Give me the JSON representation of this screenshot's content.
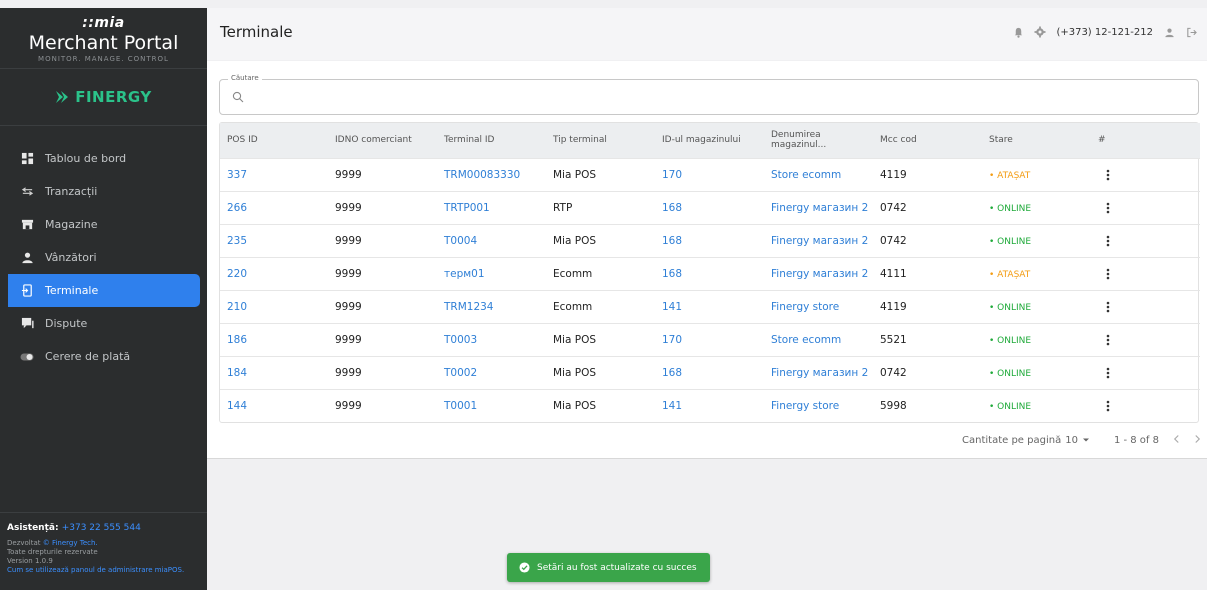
{
  "brand": {
    "logo_text": "mia",
    "title": "Merchant Portal",
    "tagline": "MONITOR. MANAGE. CONTROL",
    "merchant_logo": "FINERGY"
  },
  "nav": [
    {
      "label": "Tablou de bord",
      "icon": "dashboard-icon"
    },
    {
      "label": "Tranzacții",
      "icon": "arrows-icon"
    },
    {
      "label": "Magazine",
      "icon": "store-icon"
    },
    {
      "label": "Vânzători",
      "icon": "person-icon"
    },
    {
      "label": "Terminale",
      "icon": "terminal-icon",
      "active": true
    },
    {
      "label": "Dispute",
      "icon": "chat-icon"
    },
    {
      "label": "Cerere de plată",
      "icon": "toggle-icon"
    }
  ],
  "footer": {
    "assist_label": "Asistență:",
    "assist_phone": "+373 22 555 544",
    "dev_prefix": "Dezvoltat ",
    "dev_link": "© Finergy Tech.",
    "rights": "Toate drepturile rezervate",
    "version": "Version 1.0.9",
    "help_link": "Cum se utilizează panoul de administrare miaPOS."
  },
  "header": {
    "title": "Terminale",
    "phone": "(+373) 12-121-212"
  },
  "search": {
    "label": "Căutare",
    "value": "",
    "placeholder": ""
  },
  "table": {
    "columns": [
      "POS ID",
      "IDNO comerciant",
      "Terminal ID",
      "Tip terminal",
      "ID-ul magazinului",
      "Denumirea magazinul...",
      "Mcc cod",
      "Stare",
      "#"
    ],
    "rows": [
      {
        "pos_id": "337",
        "idno": "9999",
        "terminal_id": "TRM00083330",
        "type": "Mia POS",
        "store_id": "170",
        "store_name": "Store ecomm",
        "mcc": "4119",
        "status": "• ATAȘAT",
        "status_kind": "atasat"
      },
      {
        "pos_id": "266",
        "idno": "9999",
        "terminal_id": "TRTP001",
        "type": "RTP",
        "store_id": "168",
        "store_name": "Finergy магазин 2",
        "mcc": "0742",
        "status": "• ONLINE",
        "status_kind": "online"
      },
      {
        "pos_id": "235",
        "idno": "9999",
        "terminal_id": "T0004",
        "type": "Mia POS",
        "store_id": "168",
        "store_name": "Finergy магазин 2",
        "mcc": "0742",
        "status": "• ONLINE",
        "status_kind": "online"
      },
      {
        "pos_id": "220",
        "idno": "9999",
        "terminal_id": "терм01",
        "type": "Ecomm",
        "store_id": "168",
        "store_name": "Finergy магазин 2",
        "mcc": "4111",
        "status": "• ATAȘAT",
        "status_kind": "atasat"
      },
      {
        "pos_id": "210",
        "idno": "9999",
        "terminal_id": "TRM1234",
        "type": "Ecomm",
        "store_id": "141",
        "store_name": "Finergy store",
        "mcc": "4119",
        "status": "• ONLINE",
        "status_kind": "online"
      },
      {
        "pos_id": "186",
        "idno": "9999",
        "terminal_id": "T0003",
        "type": "Mia POS",
        "store_id": "170",
        "store_name": "Store ecomm",
        "mcc": "5521",
        "status": "• ONLINE",
        "status_kind": "online"
      },
      {
        "pos_id": "184",
        "idno": "9999",
        "terminal_id": "T0002",
        "type": "Mia POS",
        "store_id": "168",
        "store_name": "Finergy магазин 2",
        "mcc": "0742",
        "status": "• ONLINE",
        "status_kind": "online"
      },
      {
        "pos_id": "144",
        "idno": "9999",
        "terminal_id": "T0001",
        "type": "Mia POS",
        "store_id": "141",
        "store_name": "Finergy store",
        "mcc": "5998",
        "status": "• ONLINE",
        "status_kind": "online"
      }
    ]
  },
  "pager": {
    "per_page_label": "Cantitate pe pagină",
    "per_page_value": "10",
    "range": "1 - 8 of 8"
  },
  "toast": {
    "message": "Setări au fost actualizate cu succes"
  },
  "colors": {
    "accent": "#2f80ed",
    "online": "#1faa3a",
    "attached": "#f39c12",
    "success": "#3aa54a",
    "sidebar": "#2b2d2e"
  }
}
